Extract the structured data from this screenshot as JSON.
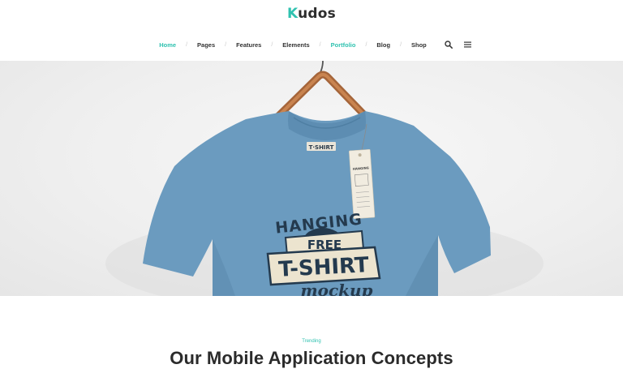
{
  "brand": {
    "logo_initial": "K",
    "logo_rest": "udos",
    "accent_color": "#30c2b0"
  },
  "nav": {
    "items": [
      {
        "label": "Home",
        "active": true
      },
      {
        "label": "Pages",
        "active": false
      },
      {
        "label": "Features",
        "active": false
      },
      {
        "label": "Elements",
        "active": false
      },
      {
        "label": "Portfolio",
        "active": true
      },
      {
        "label": "Blog",
        "active": false
      },
      {
        "label": "Shop",
        "active": false
      }
    ],
    "separator": "/",
    "search_icon": "search-icon",
    "menu_icon": "hamburger-menu-icon"
  },
  "hero": {
    "shirt_color": "#6b9bbf",
    "hanger_label": "T·SHIRT",
    "tag_text": "HANGING",
    "print_top": "HANGING",
    "print_middle": "FREE",
    "print_main": "T-SHIRT",
    "print_bottom": "mockup"
  },
  "section": {
    "eyebrow": "Trending",
    "headline": "Our Mobile Application Concepts"
  }
}
